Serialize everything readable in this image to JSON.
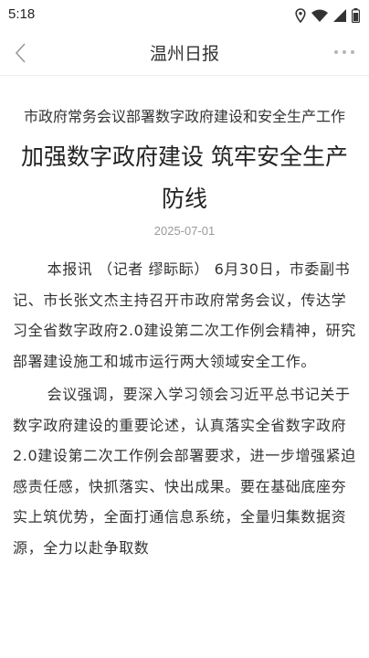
{
  "status_bar": {
    "time": "5:18",
    "icons": [
      "location-icon",
      "wifi-icon",
      "signal-icon",
      "battery-icon"
    ]
  },
  "header": {
    "title": "温州日报",
    "back_icon": "chevron-left-icon",
    "more_icon": "more-dots-icon"
  },
  "article": {
    "kicker": "市政府常务会议部署数字政府建设和安全生产工作",
    "headline": "加强数字政府建设 筑牢安全生产防线",
    "date": "2025-07-01",
    "paragraphs": [
      "本报讯 （记者 缪眎眎） 6月30日，市委副书记、市长张文杰主持召开市政府常务会议，传达学习全省数字政府2.0建设第二次工作例会精神，研究部署建设施工和城市运行两大领域安全工作。",
      "会议强调，要深入学习领会习近平总书记关于数字政府建设的重要论述，认真落实全省数字政府2.0建设第二次工作例会部署要求，进一步增强紧迫感责任感，快抓落实、快出成果。要在基础底座夯实上筑优势，全面打通信息系统，全量归集数据资源，全力以赴争取数"
    ]
  },
  "colors": {
    "background": "#ffffff",
    "text": "#333333",
    "date": "#9a9a9a",
    "divider": "#ececec"
  }
}
